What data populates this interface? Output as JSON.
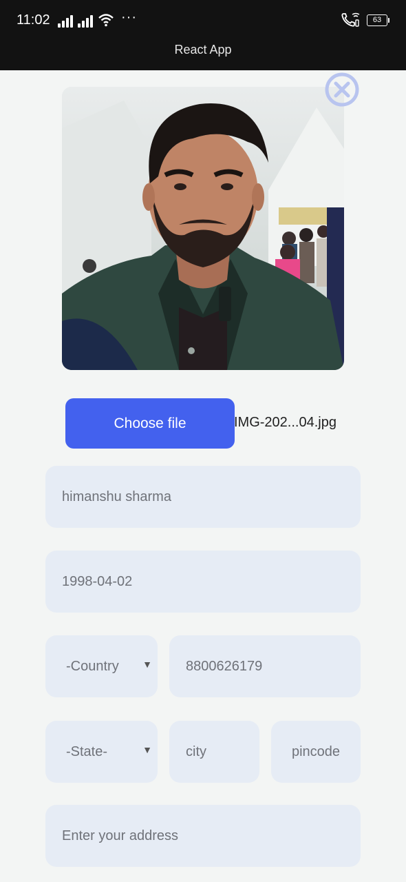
{
  "status": {
    "time": "11:02",
    "battery": "63",
    "title": "React App"
  },
  "upload": {
    "choose_label": "Choose file",
    "file_name": "IMG-202...04.jpg"
  },
  "form": {
    "name": "himanshu sharma",
    "dob": "1998-04-02",
    "country": "-Country",
    "phone": "8800626179",
    "state": "-State-",
    "city_placeholder": "city",
    "pincode_placeholder": "pincode",
    "address_placeholder": "Enter your address"
  },
  "colors": {
    "accent": "#4361ee",
    "field_bg": "#e6ecf5",
    "close_icon": "#b8c4ef"
  },
  "icons": {
    "close": "close-circle-icon",
    "photo": "profile-photo",
    "dropdown": "caret-down-icon"
  }
}
